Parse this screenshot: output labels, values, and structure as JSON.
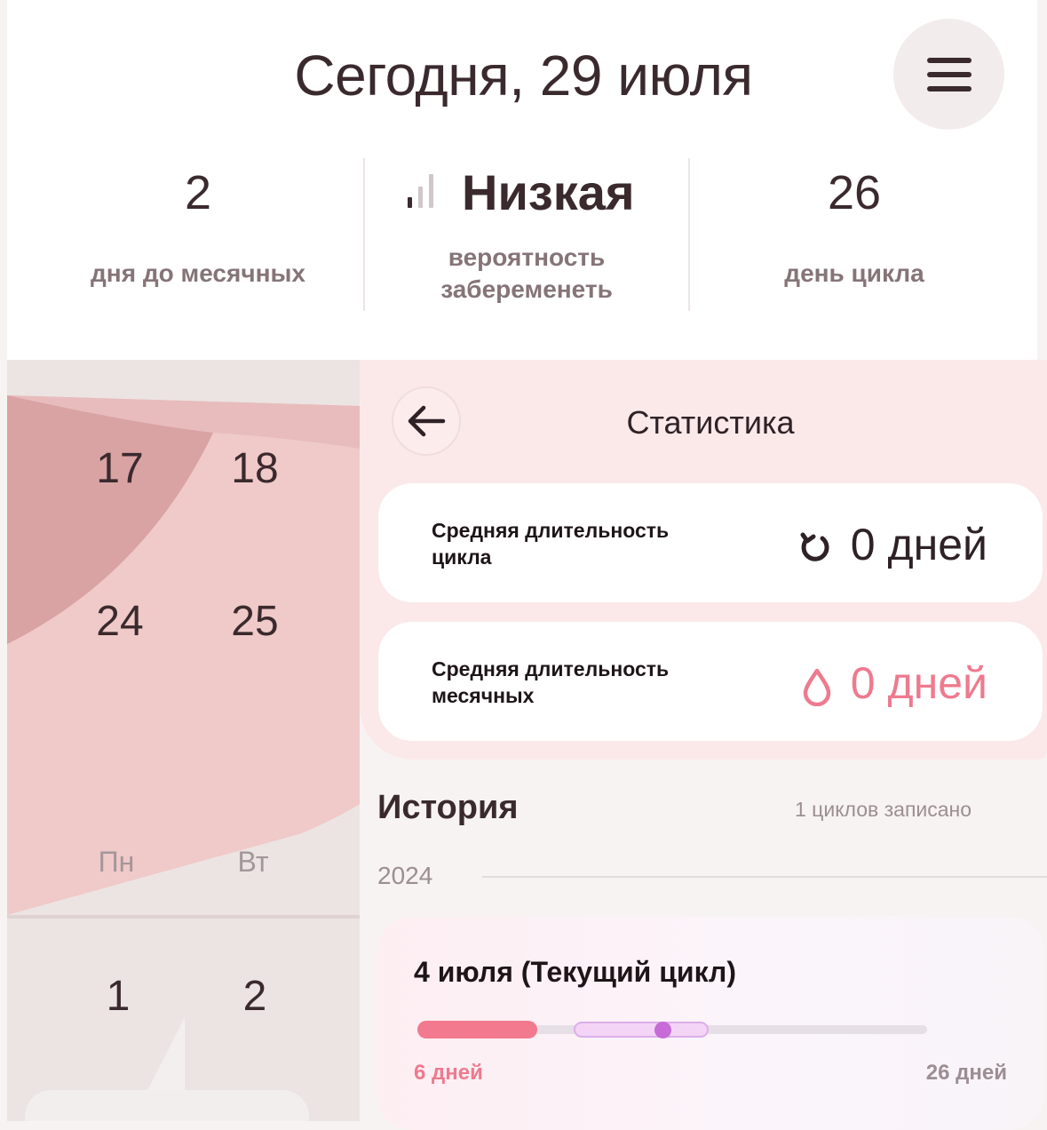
{
  "header": {
    "title": "Сегодня, 29 июля"
  },
  "summary": [
    {
      "value": "2",
      "label": "дня до месячных"
    },
    {
      "value": "Низкая",
      "label_line1": "вероятность",
      "label_line2": "забеременеть"
    },
    {
      "value": "26",
      "label": "день цикла"
    }
  ],
  "calendar": {
    "rows": [
      [
        "17",
        "18"
      ],
      [
        "24",
        "25"
      ]
    ],
    "weekdays": [
      "Пн",
      "Вт"
    ],
    "next_row": [
      "1",
      "2"
    ]
  },
  "stats": {
    "title": "Статистика",
    "cards": [
      {
        "label_line1": "Средняя длительность",
        "label_line2": "цикла",
        "value": "0 дней",
        "icon": "refresh-icon",
        "color": "#2e2226"
      },
      {
        "label_line1": "Средняя длительность",
        "label_line2": "месячных",
        "value": "0 дней",
        "icon": "drop-icon",
        "color": "#ee7a8e"
      }
    ]
  },
  "history": {
    "title": "История",
    "count": "1 циклов записано",
    "year": "2024",
    "cycle": {
      "title": "4 июля (Текущий цикл)",
      "period_label": "6 дней",
      "cycle_label": "26 дней",
      "period_days": 6,
      "cycle_days": 26
    }
  },
  "colors": {
    "accent": "#f3798e",
    "fertile": "#f4d4f6",
    "ovulation": "#c66bd8",
    "text": "#3a2a2e"
  }
}
